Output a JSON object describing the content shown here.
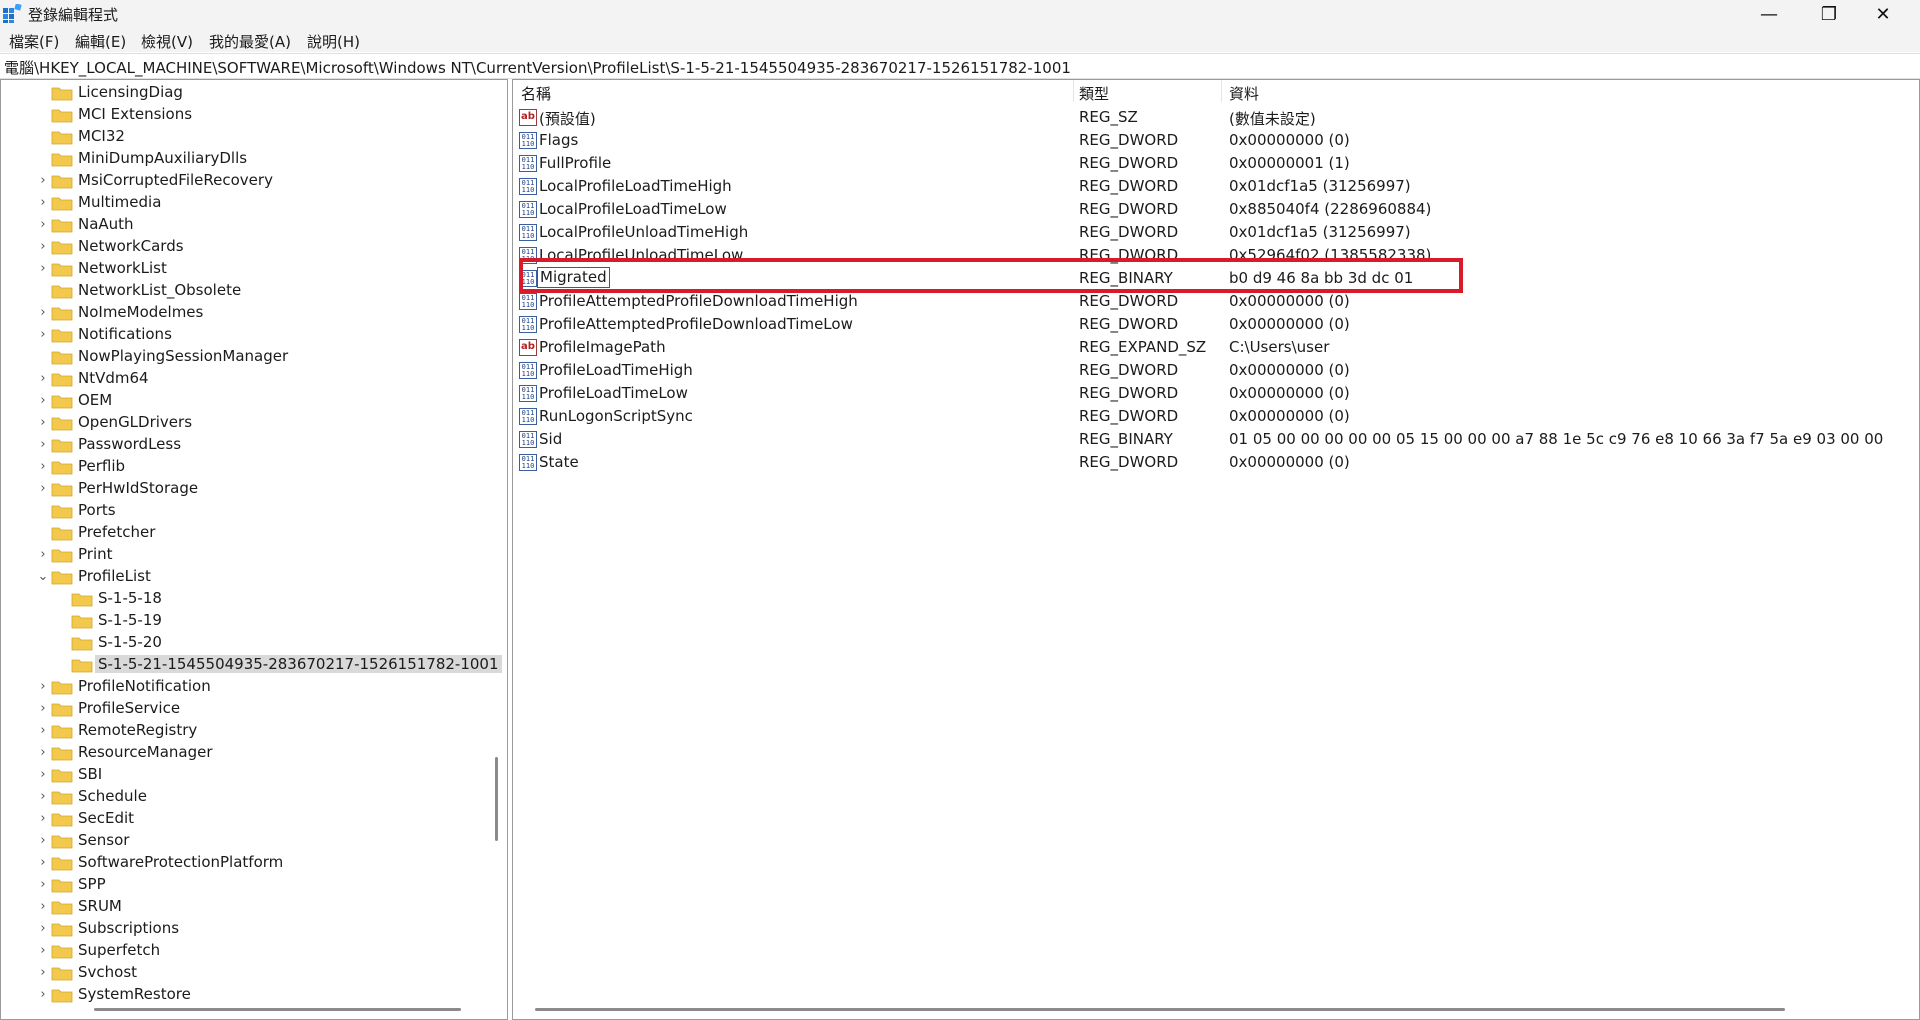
{
  "window": {
    "title": "登錄編輯程式",
    "minimize": "—",
    "maximize": "❐",
    "close": "✕"
  },
  "menu": [
    "檔案(F)",
    "編輯(E)",
    "檢視(V)",
    "我的最愛(A)",
    "說明(H)"
  ],
  "address": "電腦\\HKEY_LOCAL_MACHINE\\SOFTWARE\\Microsoft\\Windows NT\\CurrentVersion\\ProfileList\\S-1-5-21-1545504935-283670217-1526151782-1001",
  "tree": [
    {
      "label": "LicensingDiag",
      "expander": ""
    },
    {
      "label": "MCI Extensions",
      "expander": ""
    },
    {
      "label": "MCI32",
      "expander": ""
    },
    {
      "label": "MiniDumpAuxiliaryDlls",
      "expander": ""
    },
    {
      "label": "MsiCorruptedFileRecovery",
      "expander": "›"
    },
    {
      "label": "Multimedia",
      "expander": "›"
    },
    {
      "label": "NaAuth",
      "expander": "›"
    },
    {
      "label": "NetworkCards",
      "expander": "›"
    },
    {
      "label": "NetworkList",
      "expander": "›"
    },
    {
      "label": "NetworkList_Obsolete",
      "expander": ""
    },
    {
      "label": "NoImeModelmes",
      "expander": "›"
    },
    {
      "label": "Notifications",
      "expander": "›"
    },
    {
      "label": "NowPlayingSessionManager",
      "expander": ""
    },
    {
      "label": "NtVdm64",
      "expander": "›"
    },
    {
      "label": "OEM",
      "expander": "›"
    },
    {
      "label": "OpenGLDrivers",
      "expander": "›"
    },
    {
      "label": "PasswordLess",
      "expander": "›"
    },
    {
      "label": "Perflib",
      "expander": "›"
    },
    {
      "label": "PerHwIdStorage",
      "expander": "›"
    },
    {
      "label": "Ports",
      "expander": ""
    },
    {
      "label": "Prefetcher",
      "expander": ""
    },
    {
      "label": "Print",
      "expander": "›"
    },
    {
      "label": "ProfileList",
      "expander": "⌄"
    },
    {
      "label": "S-1-5-18",
      "expander": "",
      "child": true
    },
    {
      "label": "S-1-5-19",
      "expander": "",
      "child": true
    },
    {
      "label": "S-1-5-20",
      "expander": "",
      "child": true
    },
    {
      "label": "S-1-5-21-1545504935-283670217-1526151782-1001",
      "expander": "",
      "child": true,
      "selected": true
    },
    {
      "label": "ProfileNotification",
      "expander": "›"
    },
    {
      "label": "ProfileService",
      "expander": "›"
    },
    {
      "label": "RemoteRegistry",
      "expander": "›"
    },
    {
      "label": "ResourceManager",
      "expander": "›"
    },
    {
      "label": "SBI",
      "expander": "›"
    },
    {
      "label": "Schedule",
      "expander": "›"
    },
    {
      "label": "SecEdit",
      "expander": "›"
    },
    {
      "label": "Sensor",
      "expander": "›"
    },
    {
      "label": "SoftwareProtectionPlatform",
      "expander": "›"
    },
    {
      "label": "SPP",
      "expander": "›"
    },
    {
      "label": "SRUM",
      "expander": "›"
    },
    {
      "label": "Subscriptions",
      "expander": "›"
    },
    {
      "label": "Superfetch",
      "expander": "›"
    },
    {
      "label": "Svchost",
      "expander": "›"
    },
    {
      "label": "SystemRestore",
      "expander": "›"
    }
  ],
  "columns": {
    "name": "名稱",
    "type": "類型",
    "data": "資料"
  },
  "values": [
    {
      "name": "(預設值)",
      "type": "REG_SZ",
      "data": "(數值未設定)",
      "icon": "string"
    },
    {
      "name": "Flags",
      "type": "REG_DWORD",
      "data": "0x00000000 (0)",
      "icon": "binary"
    },
    {
      "name": "FullProfile",
      "type": "REG_DWORD",
      "data": "0x00000001 (1)",
      "icon": "binary"
    },
    {
      "name": "LocalProfileLoadTimeHigh",
      "type": "REG_DWORD",
      "data": "0x01dcf1a5 (31256997)",
      "icon": "binary"
    },
    {
      "name": "LocalProfileLoadTimeLow",
      "type": "REG_DWORD",
      "data": "0x885040f4 (2286960884)",
      "icon": "binary"
    },
    {
      "name": "LocalProfileUnloadTimeHigh",
      "type": "REG_DWORD",
      "data": "0x01dcf1a5 (31256997)",
      "icon": "binary"
    },
    {
      "name": "LocalProfileUnloadTimeLow",
      "type": "REG_DWORD",
      "data": "0x52964f02 (1385582338)",
      "icon": "binary"
    },
    {
      "name": "Migrated",
      "type": "REG_BINARY",
      "data": "b0 d9 46 8a bb 3d dc 01",
      "icon": "binary",
      "editing": true
    },
    {
      "name": "ProfileAttemptedProfileDownloadTimeHigh",
      "type": "REG_DWORD",
      "data": "0x00000000 (0)",
      "icon": "binary"
    },
    {
      "name": "ProfileAttemptedProfileDownloadTimeLow",
      "type": "REG_DWORD",
      "data": "0x00000000 (0)",
      "icon": "binary"
    },
    {
      "name": "ProfileImagePath",
      "type": "REG_EXPAND_SZ",
      "data": "C:\\Users\\user",
      "icon": "string"
    },
    {
      "name": "ProfileLoadTimeHigh",
      "type": "REG_DWORD",
      "data": "0x00000000 (0)",
      "icon": "binary"
    },
    {
      "name": "ProfileLoadTimeLow",
      "type": "REG_DWORD",
      "data": "0x00000000 (0)",
      "icon": "binary"
    },
    {
      "name": "RunLogonScriptSync",
      "type": "REG_DWORD",
      "data": "0x00000000 (0)",
      "icon": "binary"
    },
    {
      "name": "Sid",
      "type": "REG_BINARY",
      "data": "01 05 00 00 00 00 00 05 15 00 00 00 a7 88 1e 5c c9 76 e8 10 66 3a f7 5a e9 03 00 00",
      "icon": "binary"
    },
    {
      "name": "State",
      "type": "REG_DWORD",
      "data": "0x00000000 (0)",
      "icon": "binary"
    }
  ],
  "icons": {
    "binary_glyph": "011\n110",
    "string_glyph": "ab"
  },
  "colors": {
    "highlight": "#d81b2a",
    "folder": "#f2c94c",
    "selection": "#d9d9d9"
  }
}
